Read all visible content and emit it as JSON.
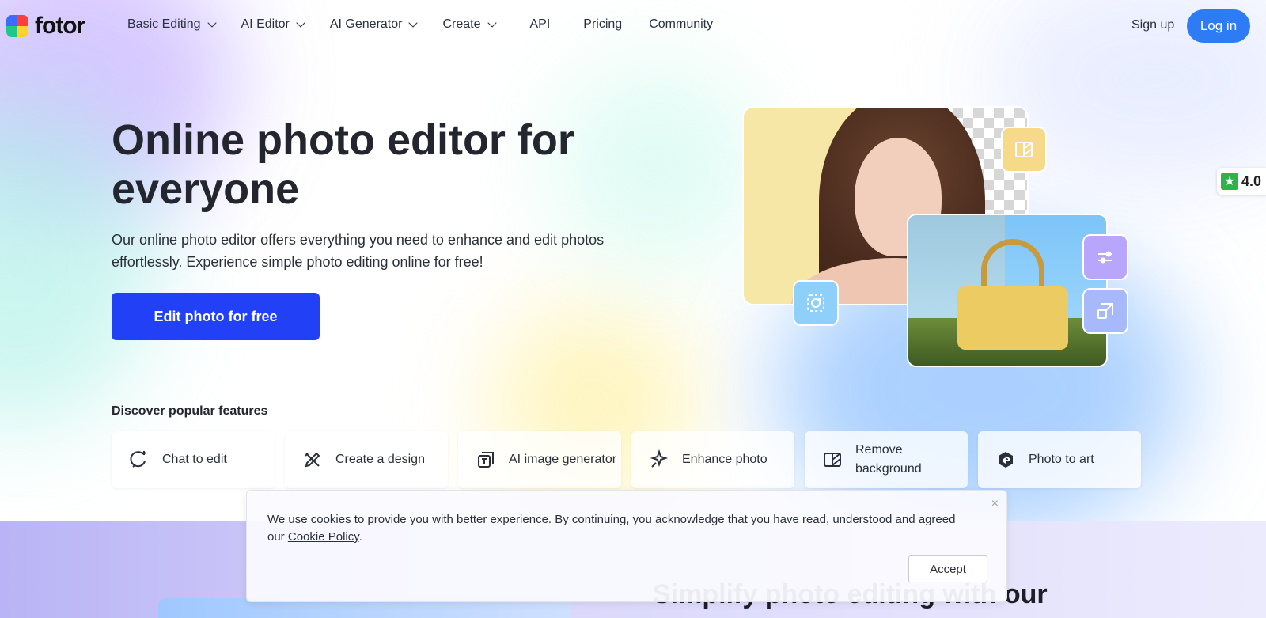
{
  "brand": {
    "name": "fotor"
  },
  "nav": {
    "items": [
      {
        "label": "Basic Editing",
        "dropdown": true
      },
      {
        "label": "AI Editor",
        "dropdown": true
      },
      {
        "label": "AI Generator",
        "dropdown": true
      },
      {
        "label": "Create",
        "dropdown": true
      },
      {
        "label": "API",
        "dropdown": false
      },
      {
        "label": "Pricing",
        "dropdown": false
      },
      {
        "label": "Community",
        "dropdown": false
      }
    ],
    "signup": "Sign up",
    "login": "Log in"
  },
  "hero": {
    "title": "Online photo editor for everyone",
    "subtitle": "Our online photo editor offers everything you need to enhance and edit photos effortlessly. Experience simple photo editing online for free!",
    "cta": "Edit photo for free"
  },
  "rating": {
    "value": "4.0"
  },
  "features": {
    "title": "Discover popular features",
    "items": [
      {
        "label": "Chat to edit",
        "icon": "chat-edit-icon"
      },
      {
        "label": "Create a design",
        "icon": "design-pencil-icon"
      },
      {
        "label": "AI image generator",
        "icon": "ai-image-icon"
      },
      {
        "label": "Enhance photo",
        "icon": "sparkle-enhance-icon"
      },
      {
        "label": "Remove background",
        "icon": "remove-bg-icon"
      },
      {
        "label": "Photo to art",
        "icon": "art-g-icon"
      }
    ]
  },
  "section": {
    "title": "Simplify photo editing with our"
  },
  "cookie": {
    "text": "We use cookies to provide you with better experience. By continuing, you acknowledge that you have read, understood and agreed our ",
    "link": "Cookie Policy",
    "period": ".",
    "accept": "Accept",
    "close": "×"
  },
  "colors": {
    "primary": "#2241f7",
    "login": "#2e7bf6",
    "rating": "#2fb24a"
  }
}
